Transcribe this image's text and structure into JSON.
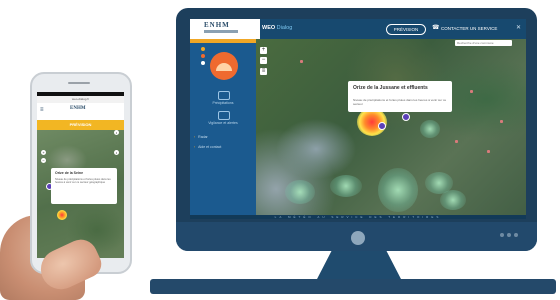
{
  "desktop": {
    "logo_text": "ENHM",
    "brand": "WEO",
    "brand_sub": "Dialog",
    "header_button": "PRÉVISION",
    "contact_label": "CONTACTER UN SERVICE",
    "search_placeholder": "Recherche d'une commune",
    "popup": {
      "title": "Orize de la Jussane et effluents",
      "body": "Niveau de précipitations et fortes pluies dans les heures à venir sur ce secteur"
    },
    "sidebar_items": [
      {
        "label": "Précipitations"
      },
      {
        "label": "Vigilance et alertes"
      }
    ],
    "sidebar_rows": [
      "Radar",
      "Aide et contact"
    ],
    "bottom_bar": "LA MÉTÉO AU SERVICE DES TERRITOIRES"
  },
  "phone": {
    "url": "weo-dialog.fr",
    "logo_text": "ENHM",
    "yellow_button": "PRÉVISION",
    "popup": {
      "title": "Orize de la Seine",
      "body": "Niveau de précipitations et fortes pluies dans les heures à venir sur ce secteur géographique"
    }
  },
  "colors": {
    "monitor_frame": "#1d3f5c",
    "accent_orange": "#f0a726",
    "sidebar_blue": "#1b5a8f",
    "mobile_yellow": "#f2b623",
    "storm_red": "#ff3b3b"
  },
  "icons": [
    "menu-icon",
    "phone-icon",
    "close-icon",
    "sun-icon",
    "map-pin-icon"
  ]
}
